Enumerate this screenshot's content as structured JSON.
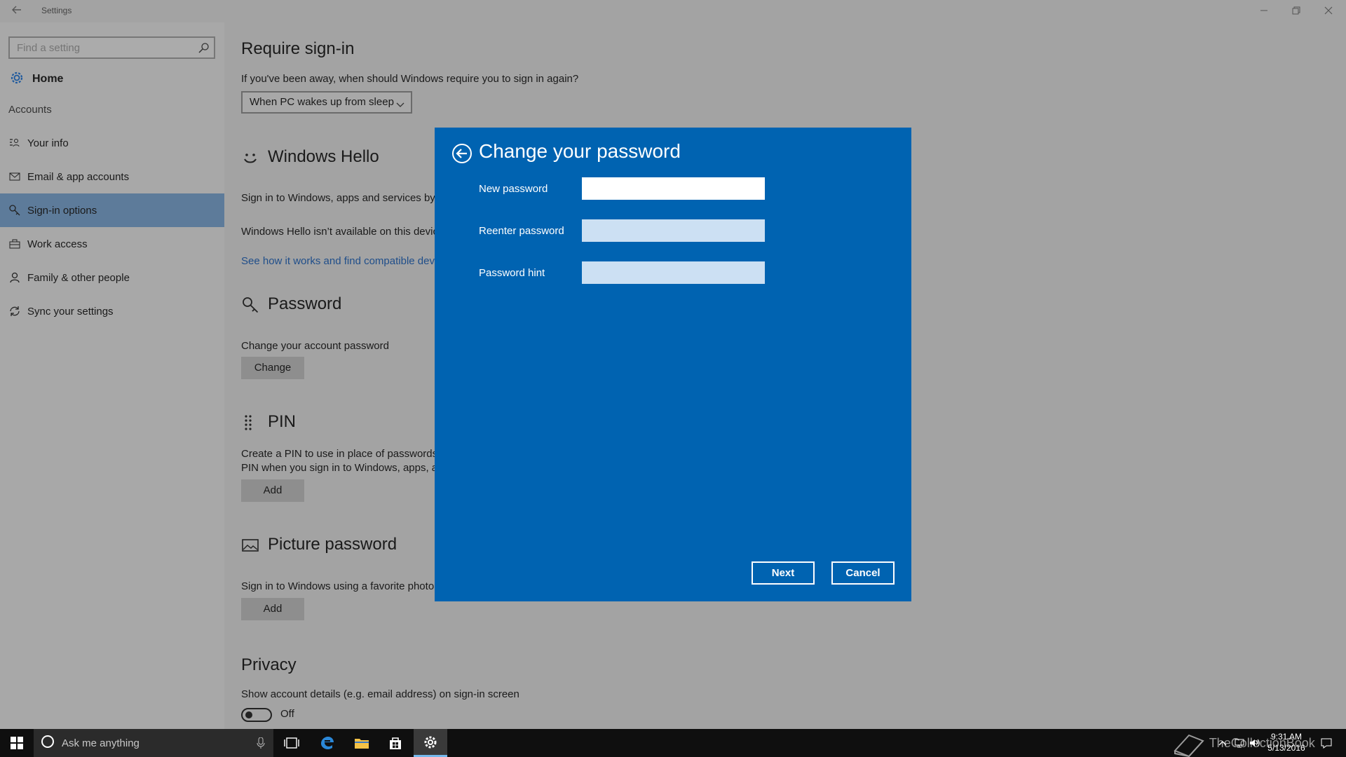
{
  "window": {
    "title": "Settings"
  },
  "sidebar": {
    "search_placeholder": "Find a setting",
    "home_label": "Home",
    "section_label": "Accounts",
    "items": [
      {
        "label": "Your info",
        "icon": "contact-card-icon"
      },
      {
        "label": "Email & app accounts",
        "icon": "mail-icon"
      },
      {
        "label": "Sign-in options",
        "icon": "key-icon",
        "selected": true
      },
      {
        "label": "Work access",
        "icon": "briefcase-icon"
      },
      {
        "label": "Family & other people",
        "icon": "person-icon"
      },
      {
        "label": "Sync your settings",
        "icon": "sync-icon"
      }
    ]
  },
  "main": {
    "require_signin": {
      "heading": "Require sign-in",
      "question": "If you've been away, when should Windows require you to sign in again?",
      "dropdown_value": "When PC wakes up from sleep"
    },
    "hello": {
      "heading": "Windows Hello",
      "desc": "Sign in to Windows, apps and services by",
      "unavailable": "Windows Hello isn’t available on this devic",
      "link": "See how it works and find compatible dev"
    },
    "password": {
      "heading": "Password",
      "desc": "Change your account password",
      "button": "Change"
    },
    "pin": {
      "heading": "PIN",
      "desc_line1": "Create a PIN to use in place of passwords.",
      "desc_line2": "PIN when you sign in to Windows, apps, a",
      "button": "Add"
    },
    "picture_password": {
      "heading": "Picture password",
      "desc": "Sign in to Windows using a favorite photo",
      "button": "Add"
    },
    "privacy": {
      "heading": "Privacy",
      "desc": "Show account details (e.g. email address) on sign-in screen",
      "toggle_state": "Off"
    }
  },
  "dialog": {
    "title": "Change your password",
    "fields": {
      "new_password": {
        "label": "New password",
        "value": ""
      },
      "reenter_password": {
        "label": "Reenter password",
        "value": ""
      },
      "password_hint": {
        "label": "Password hint",
        "value": ""
      }
    },
    "next_label": "Next",
    "cancel_label": "Cancel",
    "accent_color": "#0063b1"
  },
  "taskbar": {
    "search_placeholder": "Ask me anything",
    "time": "9:31 AM",
    "date": "5/13/2016",
    "watermark": "TheCollectionBook"
  }
}
